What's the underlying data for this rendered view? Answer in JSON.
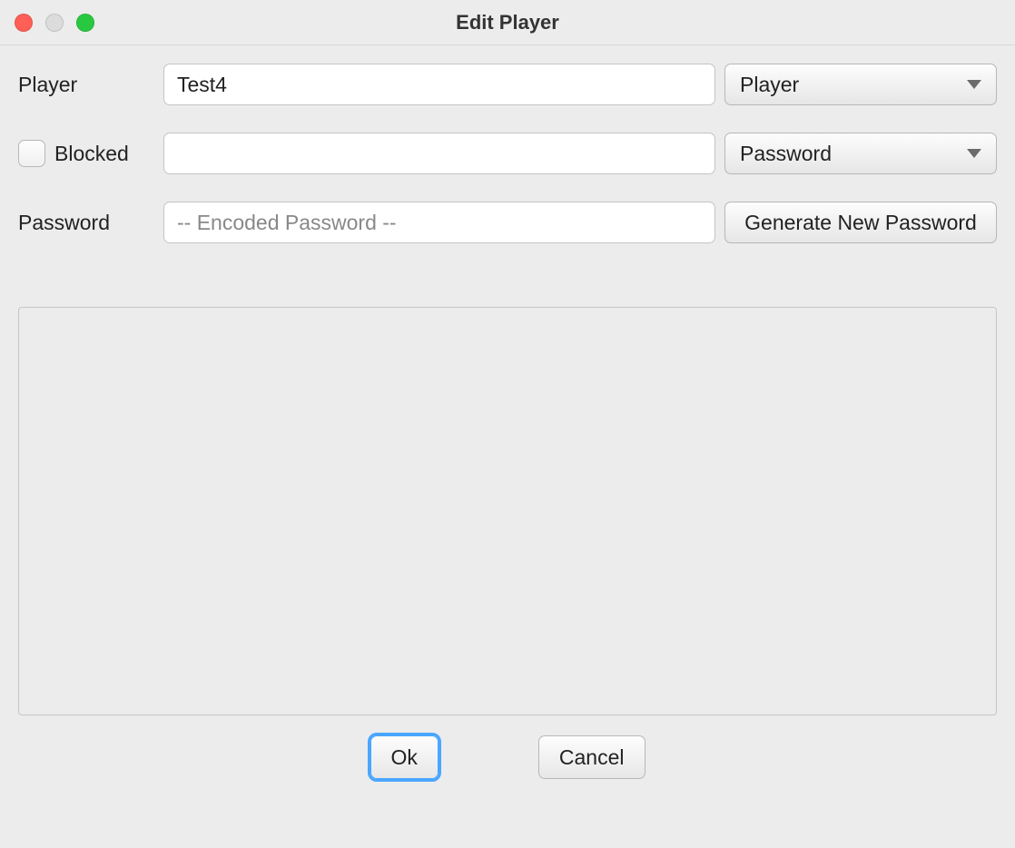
{
  "window": {
    "title": "Edit Player"
  },
  "labels": {
    "player": "Player",
    "blocked": "Blocked",
    "password": "Password"
  },
  "inputs": {
    "player_value": "Test4",
    "blocked_value": "",
    "password_placeholder": "-- Encoded Password --",
    "password_value": ""
  },
  "selects": {
    "player_type": "Player",
    "auth_type": "Password"
  },
  "buttons": {
    "generate_password": "Generate New Password",
    "ok": "Ok",
    "cancel": "Cancel"
  }
}
